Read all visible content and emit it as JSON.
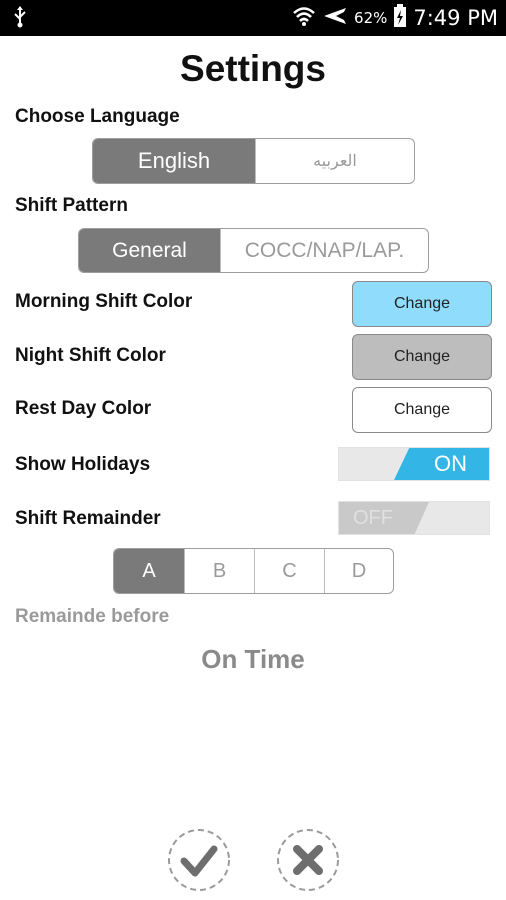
{
  "status_bar": {
    "battery": "62%",
    "time": "7:49 PM"
  },
  "title": "Settings",
  "language": {
    "label": "Choose Language",
    "options": [
      "English",
      "العربيه"
    ],
    "selected": "English"
  },
  "shift_pattern": {
    "label": "Shift Pattern",
    "options": [
      "General",
      "COCC/NAP/LAP."
    ],
    "selected": "General"
  },
  "colors": {
    "morning": {
      "label": "Morning Shift Color",
      "button": "Change",
      "color": "#8fdcfc"
    },
    "night": {
      "label": "Night Shift Color",
      "button": "Change",
      "color": "#bdbdbd"
    },
    "rest": {
      "label": "Rest Day Color",
      "button": "Change",
      "color": "#ffffff"
    }
  },
  "show_holidays": {
    "label": "Show Holidays",
    "state": "ON"
  },
  "shift_reminder": {
    "label": "Shift Remainder",
    "state": "OFF"
  },
  "reminder_options": {
    "options": [
      "A",
      "B",
      "C",
      "D"
    ],
    "selected": "A"
  },
  "remind_before": {
    "label": "Remainde before",
    "value": "On Time"
  },
  "accent_color": "#33b5e5"
}
